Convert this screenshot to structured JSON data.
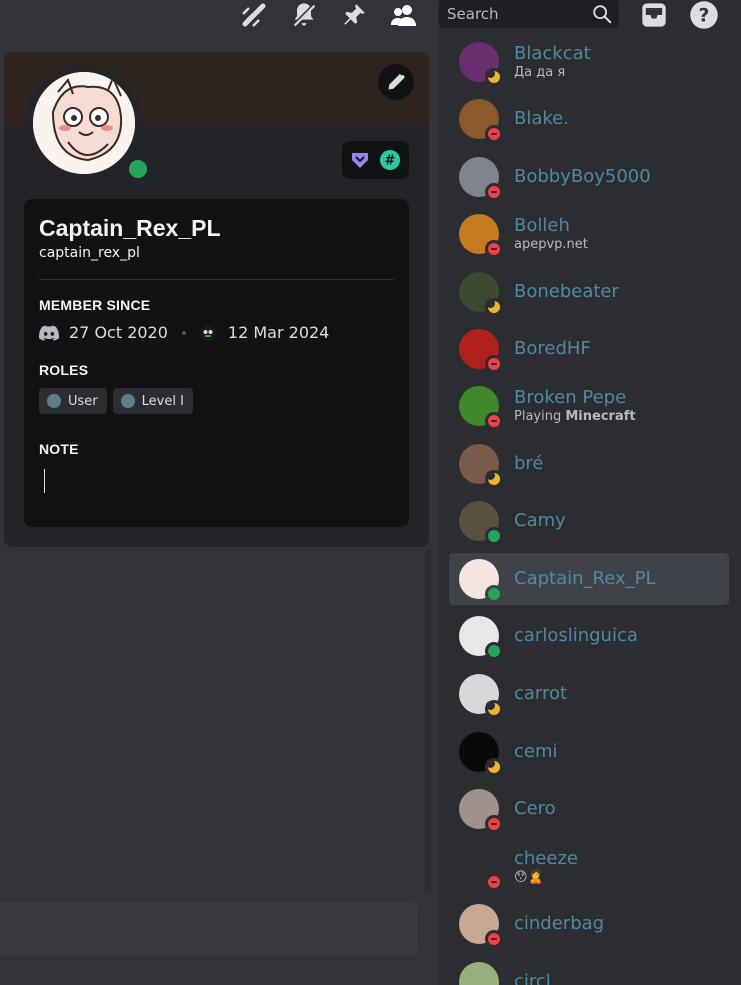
{
  "search": {
    "placeholder": "Search"
  },
  "profile": {
    "display_name": "Captain_Rex_PL",
    "username": "captain_rex_pl",
    "member_since_title": "MEMBER SINCE",
    "discord_since": "27 Oct 2020",
    "server_since": "12 Mar 2024",
    "roles_title": "ROLES",
    "roles": [
      {
        "label": "User",
        "color": "#607d8b"
      },
      {
        "label": "Level I",
        "color": "#607d8b"
      }
    ],
    "note_title": "NOTE",
    "status": "online"
  },
  "members": [
    {
      "name": "Blackcat",
      "sub": "Да да я",
      "status": "idle",
      "avatar": "#6a2f6e"
    },
    {
      "name": "Blake.",
      "sub": "",
      "status": "dnd",
      "avatar": "#8a5a2a"
    },
    {
      "name": "BobbyBoy5000",
      "sub": "",
      "status": "dnd",
      "avatar": "#80848e"
    },
    {
      "name": "Bolleh",
      "sub": "apepvp.net",
      "status": "dnd",
      "avatar": "#c47a1e"
    },
    {
      "name": "Bonebeater",
      "sub": "",
      "status": "idle",
      "avatar": "#3d4a32"
    },
    {
      "name": "BoredHF",
      "sub": "",
      "status": "dnd",
      "avatar": "#b0201c"
    },
    {
      "name": "Broken Pepe",
      "sub_prefix": "Playing ",
      "sub_bold": "Minecraft",
      "status": "dnd",
      "avatar": "#3e8a2a"
    },
    {
      "name": "bré",
      "sub": "",
      "status": "idle",
      "avatar": "#7a5a48"
    },
    {
      "name": "Camy",
      "sub": "",
      "status": "online",
      "avatar": "#5a5040"
    },
    {
      "name": "Captain_Rex_PL",
      "sub": "",
      "status": "online",
      "avatar": "#f3e6e0",
      "selected": true
    },
    {
      "name": "carloslinguica",
      "sub": "",
      "status": "online",
      "avatar": "#e8e8e8"
    },
    {
      "name": "carrot",
      "sub": "",
      "status": "idle",
      "avatar": "#d8d8d8"
    },
    {
      "name": "cemi",
      "sub": "",
      "status": "idle",
      "avatar": "#0a0a0a"
    },
    {
      "name": "Cero",
      "sub": "",
      "status": "dnd",
      "avatar": "#a0908e"
    },
    {
      "name": "cheeze",
      "sub": "😯🙎",
      "status": "dnd",
      "avatar": "#2b2d31"
    },
    {
      "name": "cinderbag",
      "sub": "",
      "status": "dnd",
      "avatar": "#c8a890"
    },
    {
      "name": "circl",
      "sub": "",
      "status": "online",
      "avatar": "#9ab07a"
    }
  ]
}
